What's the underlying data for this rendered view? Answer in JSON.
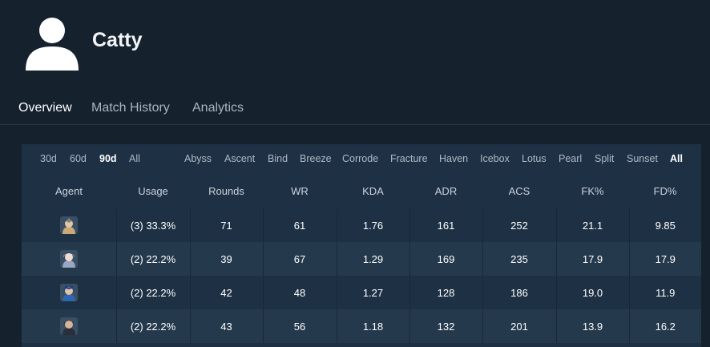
{
  "profile": {
    "name": "Catty"
  },
  "tabs": [
    {
      "label": "Overview",
      "active": true
    },
    {
      "label": "Match History",
      "active": false
    },
    {
      "label": "Analytics",
      "active": false
    }
  ],
  "time_filters": [
    {
      "label": "30d",
      "active": false
    },
    {
      "label": "60d",
      "active": false
    },
    {
      "label": "90d",
      "active": true
    },
    {
      "label": "All",
      "active": false
    }
  ],
  "map_filters": [
    {
      "label": "Abyss",
      "active": false
    },
    {
      "label": "Ascent",
      "active": false
    },
    {
      "label": "Bind",
      "active": false
    },
    {
      "label": "Breeze",
      "active": false
    },
    {
      "label": "Corrode",
      "active": false
    },
    {
      "label": "Fracture",
      "active": false
    },
    {
      "label": "Haven",
      "active": false
    },
    {
      "label": "Icebox",
      "active": false
    },
    {
      "label": "Lotus",
      "active": false
    },
    {
      "label": "Pearl",
      "active": false
    },
    {
      "label": "Split",
      "active": false
    },
    {
      "label": "Sunset",
      "active": false
    },
    {
      "label": "All",
      "active": true
    }
  ],
  "table": {
    "headers": [
      "Agent",
      "Usage",
      "Rounds",
      "WR",
      "KDA",
      "ADR",
      "ACS",
      "FK%",
      "FD%"
    ],
    "rows": [
      {
        "agent_icon": "agent-portrait-1-icon",
        "usage": "(3) 33.3%",
        "rounds": "71",
        "wr": "61",
        "kda": "1.76",
        "adr": "161",
        "acs": "252",
        "fk": "21.1",
        "fd": "9.85"
      },
      {
        "agent_icon": "agent-portrait-2-icon",
        "usage": "(2) 22.2%",
        "rounds": "39",
        "wr": "67",
        "kda": "1.29",
        "adr": "169",
        "acs": "235",
        "fk": "17.9",
        "fd": "17.9"
      },
      {
        "agent_icon": "agent-portrait-3-icon",
        "usage": "(2) 22.2%",
        "rounds": "42",
        "wr": "48",
        "kda": "1.27",
        "adr": "128",
        "acs": "186",
        "fk": "19.0",
        "fd": "11.9"
      },
      {
        "agent_icon": "agent-portrait-4-icon",
        "usage": "(2) 22.2%",
        "rounds": "43",
        "wr": "56",
        "kda": "1.18",
        "adr": "132",
        "acs": "201",
        "fk": "13.9",
        "fd": "16.2"
      }
    ]
  },
  "colors": {
    "background": "#15212d",
    "panel": "#1e3144",
    "row_alt": "#25394d"
  }
}
